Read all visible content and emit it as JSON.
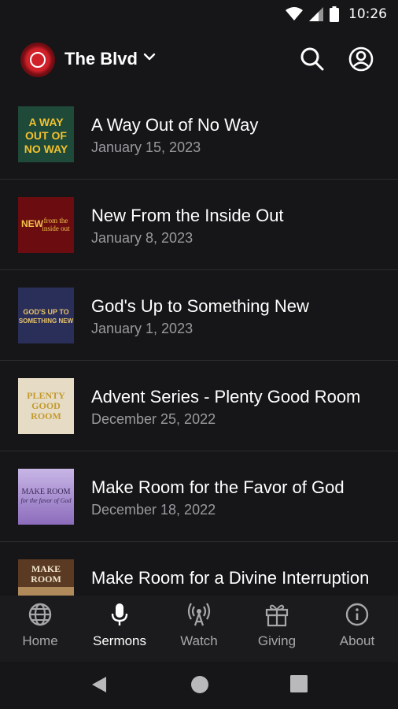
{
  "status": {
    "time": "10:26"
  },
  "header": {
    "title": "The Blvd"
  },
  "sermons": [
    {
      "title": "A Way Out of No Way",
      "date": "January 15, 2023",
      "thumb_text": "A WAY OUT OF NO WAY",
      "thumb_bg": "#1f4a3a",
      "thumb_fg": "#f2c12e"
    },
    {
      "title": "New From the Inside Out",
      "date": "January 8, 2023",
      "thumb_text": "NEW from the inside out",
      "thumb_bg": "#6b0d10",
      "thumb_fg": "#f0c24a"
    },
    {
      "title": "God's Up to Something New",
      "date": "January 1, 2023",
      "thumb_text": "GOD'S UP TO SOMETHING NEW",
      "thumb_bg": "#2a2f5a",
      "thumb_fg": "#e9c46a"
    },
    {
      "title": "Advent Series - Plenty Good Room",
      "date": "December 25, 2022",
      "thumb_text": "PLENTY GOOD ROOM",
      "thumb_bg": "#e6dcc6",
      "thumb_fg": "#c49a2e"
    },
    {
      "title": "Make Room for the Favor of God",
      "date": "December 18, 2022",
      "thumb_text": "MAKE ROOM",
      "thumb_bg": "#a98cc8",
      "thumb_fg": "#3b2a5a"
    },
    {
      "title": "Make Room for a Divine Interruption",
      "date": "",
      "thumb_text": "MAKE ROOM",
      "thumb_bg": "#5a3a22",
      "thumb_fg": "#f3e6cf"
    }
  ],
  "nav": [
    {
      "label": "Home",
      "icon": "globe-icon",
      "active": false
    },
    {
      "label": "Sermons",
      "icon": "microphone-icon",
      "active": true
    },
    {
      "label": "Watch",
      "icon": "broadcast-icon",
      "active": false
    },
    {
      "label": "Giving",
      "icon": "gift-icon",
      "active": false
    },
    {
      "label": "About",
      "icon": "info-icon",
      "active": false
    }
  ],
  "colors": {
    "background": "#161618",
    "divider": "#2c2c2e",
    "muted": "#9a9a9e",
    "brand": "#d0202a"
  }
}
